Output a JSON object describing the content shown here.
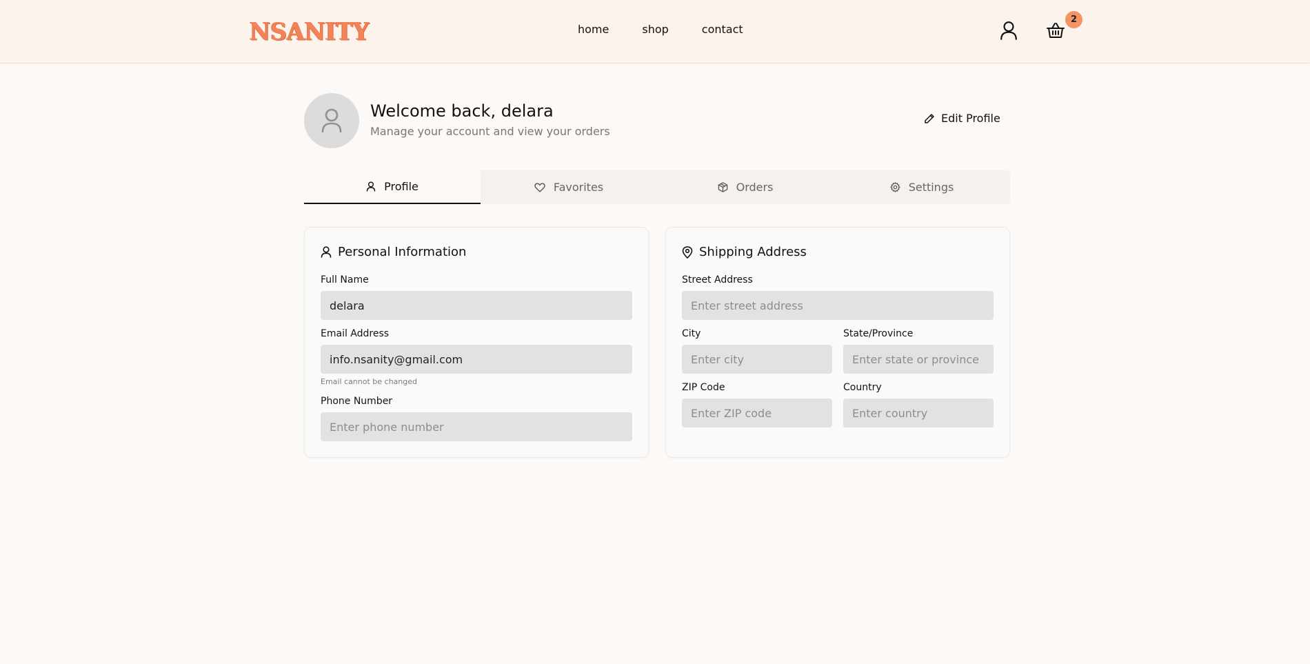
{
  "header": {
    "logo": "NSANITY",
    "nav": [
      "home",
      "shop",
      "contact"
    ],
    "cart_count": "2",
    "accent_color": "#f2845a"
  },
  "profile": {
    "welcome": "Welcome back, delara",
    "subtitle": "Manage your account and view your orders",
    "edit_label": "Edit Profile"
  },
  "tabs": [
    {
      "label": "Profile",
      "icon": "user-icon",
      "active": true
    },
    {
      "label": "Favorites",
      "icon": "heart-icon",
      "active": false
    },
    {
      "label": "Orders",
      "icon": "package-icon",
      "active": false
    },
    {
      "label": "Settings",
      "icon": "gear-icon",
      "active": false
    }
  ],
  "personal": {
    "title": "Personal Information",
    "full_name_label": "Full Name",
    "full_name_value": "delara",
    "email_label": "Email Address",
    "email_value": "info.nsanity@gmail.com",
    "email_hint": "Email cannot be changed",
    "phone_label": "Phone Number",
    "phone_placeholder": "Enter phone number"
  },
  "shipping": {
    "title": "Shipping Address",
    "street_label": "Street Address",
    "street_placeholder": "Enter street address",
    "city_label": "City",
    "city_placeholder": "Enter city",
    "state_label": "State/Province",
    "state_placeholder": "Enter state or province",
    "zip_label": "ZIP Code",
    "zip_placeholder": "Enter ZIP code",
    "country_label": "Country",
    "country_placeholder": "Enter country"
  }
}
